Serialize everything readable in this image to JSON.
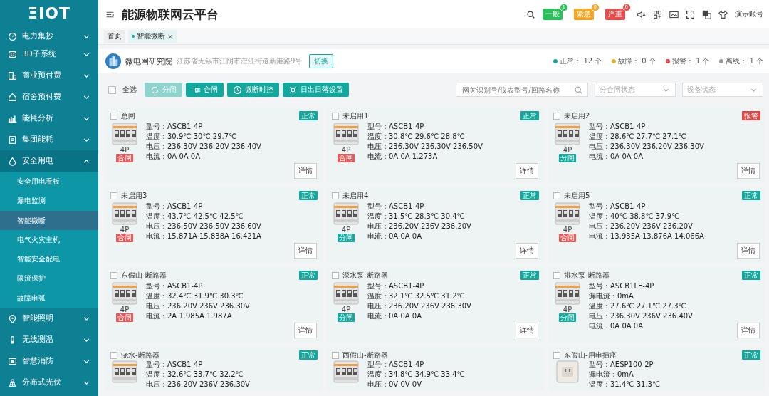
{
  "sidebar": {
    "logo": "ΞIOT",
    "items": [
      {
        "label": "电力集抄",
        "expanded": false
      },
      {
        "label": "3D子系统",
        "expanded": false
      },
      {
        "label": "商业预付费",
        "expanded": false
      },
      {
        "label": "宿舍预付费",
        "expanded": false
      },
      {
        "label": "能耗分析",
        "expanded": false
      },
      {
        "label": "集团能耗",
        "expanded": false
      },
      {
        "label": "安全用电",
        "expanded": true,
        "children": [
          {
            "label": "安全用电看板",
            "selected": false
          },
          {
            "label": "漏电监测",
            "selected": false
          },
          {
            "label": "智能微断",
            "selected": true
          },
          {
            "label": "电气火灾主机",
            "selected": false
          },
          {
            "label": "智能安全配电",
            "selected": false
          },
          {
            "label": "限流保护",
            "selected": false
          },
          {
            "label": "故障电弧",
            "selected": false
          }
        ]
      },
      {
        "label": "智能照明",
        "expanded": false
      },
      {
        "label": "无线测温",
        "expanded": false
      },
      {
        "label": "智慧消防",
        "expanded": false
      },
      {
        "label": "分布式光伏",
        "expanded": false
      }
    ]
  },
  "header": {
    "title": "能源物联网云平台",
    "alerts": [
      {
        "label": "一般",
        "count": "1",
        "kind": "general"
      },
      {
        "label": "紧急",
        "count": "0",
        "kind": "urgent"
      },
      {
        "label": "严重",
        "count": "0",
        "kind": "severe"
      }
    ],
    "user": "演示账号"
  },
  "tabs": [
    {
      "label": "首页",
      "selected": false
    },
    {
      "label": "智能微断",
      "selected": true,
      "close": "×"
    }
  ],
  "site": {
    "name": "微电网研究院",
    "address": "江苏省无锡市江阴市澄江街道新港路9号",
    "switch_button": "切换",
    "stats": [
      {
        "label": "正常：",
        "value": "12 个",
        "color": "#16a89c"
      },
      {
        "label": "故障：",
        "value": "0 个",
        "color": "#e6b422"
      },
      {
        "label": "报警：",
        "value": "1 个",
        "color": "#e04646"
      },
      {
        "label": "离线：",
        "value": "1 个",
        "color": "#999999"
      }
    ]
  },
  "toolbar": {
    "select_all": {
      "label": "全选",
      "checked": false
    },
    "buttons": [
      {
        "label": "分闸",
        "disabled": true
      },
      {
        "label": "合闸",
        "disabled": false
      },
      {
        "label": "微断时控",
        "disabled": false
      },
      {
        "label": "日出日落设置",
        "disabled": false
      }
    ],
    "search": {
      "placeholder": "网关识别号/仪表型号/回路名称"
    },
    "filters": [
      {
        "placeholder": "分合闸状态"
      },
      {
        "placeholder": "设备状态"
      }
    ]
  },
  "cards": [
    {
      "title": "总闸",
      "checked": false,
      "status": {
        "text": "正常",
        "kind": "normal"
      },
      "kind": "breaker",
      "poles": "4P",
      "switch": {
        "text": "合闸",
        "kind": "closed"
      },
      "lines": [
        "型号：ASCB1-4P",
        "温度：30.9℃ 30℃ 29.7℃",
        "电压：236.30V 236.20V 236.40V",
        "电流：0A 0A 0A"
      ],
      "detail": "详情"
    },
    {
      "title": "未启用1",
      "checked": false,
      "status": {
        "text": "正常",
        "kind": "normal"
      },
      "kind": "breaker",
      "poles": "4P",
      "switch": {
        "text": "合闸",
        "kind": "closed"
      },
      "lines": [
        "型号：ASCB1-4P",
        "温度：30.8℃ 29.6℃ 28.8℃",
        "电压：236.30V 236.30V 236.50V",
        "电流：0A 0A 1.273A"
      ],
      "detail": "详情"
    },
    {
      "title": "未启用2",
      "checked": false,
      "status": {
        "text": "报警",
        "kind": "alarm"
      },
      "kind": "breaker",
      "poles": "4P",
      "switch": {
        "text": "分闸",
        "kind": "open"
      },
      "lines": [
        "型号：ASCB1-4P",
        "温度：28.6℃ 27.7℃ 27.1℃",
        "电压：236.30V 236.20V 236.30V",
        "电流：0A 0A 0A"
      ],
      "detail": "详情"
    },
    {
      "title": "未启用3",
      "checked": false,
      "status": {
        "text": "正常",
        "kind": "normal"
      },
      "kind": "breaker",
      "poles": "4P",
      "switch": {
        "text": "合闸",
        "kind": "closed"
      },
      "lines": [
        "型号：ASCB1-4P",
        "温度：43.7℃ 42.5℃ 42.5℃",
        "电压：236.50V 236.50V 236.60V",
        "电流：15.871A 15.838A 16.421A"
      ],
      "detail": "详情"
    },
    {
      "title": "未启用4",
      "checked": false,
      "status": {
        "text": "正常",
        "kind": "normal"
      },
      "kind": "breaker",
      "poles": "4P",
      "switch": {
        "text": "分闸",
        "kind": "open"
      },
      "lines": [
        "型号：ASCB1-4P",
        "温度：31.5℃ 28.3℃ 30.4℃",
        "电压：236.20V 236V 236.20V",
        "电流：0A 0A 0A"
      ],
      "detail": "详情"
    },
    {
      "title": "未启用5",
      "checked": false,
      "status": {
        "text": "正常",
        "kind": "normal"
      },
      "kind": "breaker",
      "poles": "4P",
      "switch": {
        "text": "合闸",
        "kind": "closed"
      },
      "lines": [
        "型号：ASCB1-4P",
        "温度：40℃ 38.8℃ 37.9℃",
        "电压：236.20V 236V 236.20V",
        "电流：13.935A 13.876A 14.066A"
      ],
      "detail": "详情"
    },
    {
      "title": "东假山-断路器",
      "checked": false,
      "status": {
        "text": "正常",
        "kind": "normal"
      },
      "kind": "breaker",
      "poles": "4P",
      "switch": {
        "text": "合闸",
        "kind": "closed"
      },
      "lines": [
        "型号：ASCB1-4P",
        "温度：32.4℃ 31.9℃ 30.3℃",
        "电压：236.20V 236V 236.30V",
        "电流：2A 1.985A 1.987A"
      ],
      "detail": "详情"
    },
    {
      "title": "深水泵-断路器",
      "checked": false,
      "status": {
        "text": "正常",
        "kind": "normal"
      },
      "kind": "breaker",
      "poles": "4P",
      "switch": {
        "text": "分闸",
        "kind": "open"
      },
      "lines": [
        "型号：ASCB1-4P",
        "温度：32.1℃ 32.5℃ 31.2℃",
        "电压：236.20V 236V 236.30V",
        "电流：0A 0A 0A"
      ],
      "detail": "详情"
    },
    {
      "title": "排水泵-断路器",
      "checked": false,
      "status": {
        "text": "正常",
        "kind": "normal"
      },
      "kind": "breaker",
      "poles": "4P",
      "switch": {
        "text": "分闸",
        "kind": "open"
      },
      "lines": [
        "型号：ASCB1LE-4P",
        "漏电流：0mA",
        "温度：27.6℃ 27.1℃ 27.3℃",
        "电压：236.30V 236V 236.40V",
        "电流：0A 0A 0A"
      ],
      "detail": "详情"
    },
    {
      "title": "浇水-断路器",
      "checked": false,
      "status": {
        "text": "正常",
        "kind": "normal"
      },
      "kind": "breaker",
      "lines": [
        "型号：ASCB1-4P",
        "温度：32.6℃ 33.7℃ 32.2℃",
        "电压：236.20V 236V 236.30V"
      ]
    },
    {
      "title": "西假山-断路器",
      "checked": false,
      "kind": "breaker",
      "lines": [
        "型号：ASCB1-4P",
        "温度：34.8℃ 34.9℃ 33.4℃",
        "电压：0V 0V 0V"
      ]
    },
    {
      "title": "东假山-用电插座",
      "checked": false,
      "status": {
        "text": "正常",
        "kind": "normal"
      },
      "kind": "socket",
      "lines": [
        "型号：AESP100-2P",
        "漏电流：0mA",
        "温度：31.4℃ 31.3℃"
      ]
    }
  ]
}
